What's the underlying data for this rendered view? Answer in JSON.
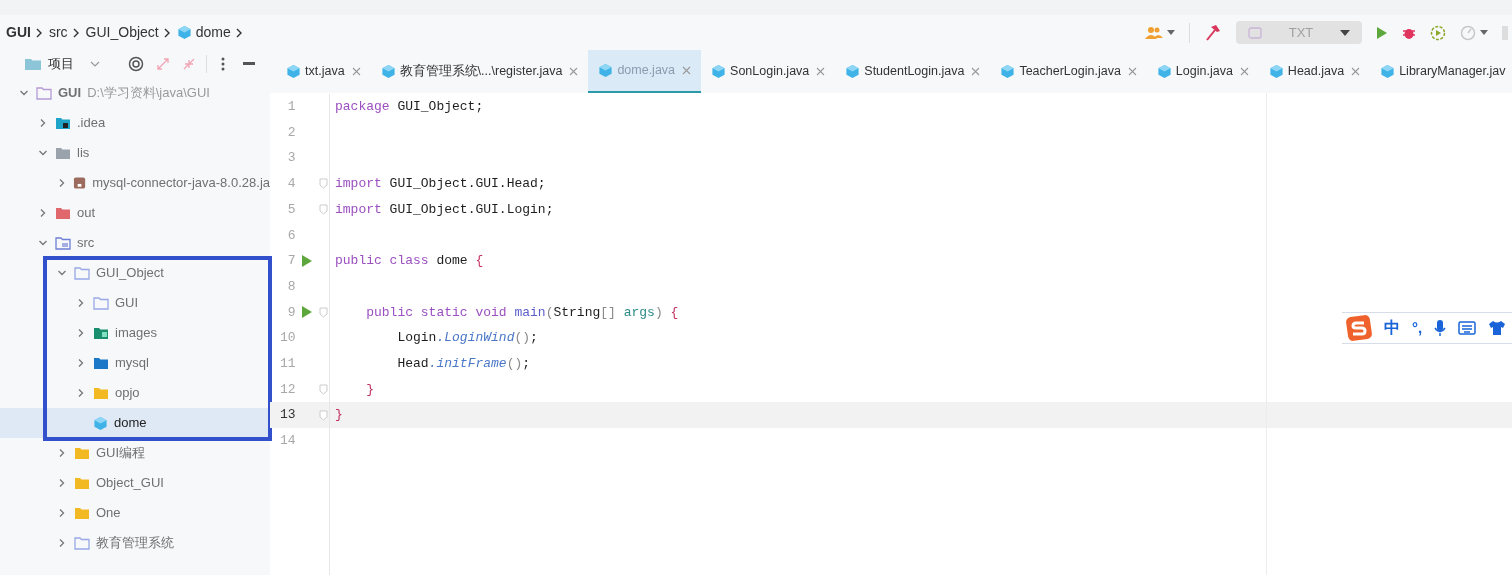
{
  "breadcrumbs": [
    {
      "label": "GUI",
      "bold": true
    },
    {
      "label": "src",
      "bold": false
    },
    {
      "label": "GUI_Object",
      "bold": false
    },
    {
      "label": "dome",
      "bold": false,
      "kind": "class"
    }
  ],
  "toolbar": {
    "run_config": {
      "label": "TXT",
      "disabled": true
    }
  },
  "project_panel": {
    "title": "项目",
    "tree": [
      {
        "label": "GUI",
        "path": "D:\\学习资料\\java\\GUI",
        "kind": "module",
        "expanded": true,
        "selected": false,
        "children": [
          {
            "label": ".idea",
            "kind": "idea",
            "expanded": false,
            "selected": false
          },
          {
            "label": "lis",
            "kind": "plain",
            "expanded": true,
            "selected": false,
            "children": [
              {
                "label": "mysql-connector-java-8.0.28.ja",
                "kind": "jar",
                "expanded": false,
                "selected": false
              }
            ]
          },
          {
            "label": "out",
            "kind": "excluded",
            "expanded": false,
            "selected": false
          },
          {
            "label": "src",
            "kind": "source",
            "expanded": true,
            "selected": false,
            "children": [
              {
                "label": "GUI_Object",
                "kind": "package",
                "expanded": true,
                "selected": false,
                "highlighted": true,
                "children": [
                  {
                    "label": "GUI",
                    "kind": "package",
                    "expanded": false,
                    "selected": false
                  },
                  {
                    "label": "images",
                    "kind": "resources",
                    "expanded": false,
                    "selected": false
                  },
                  {
                    "label": "mysql",
                    "kind": "blue",
                    "expanded": false,
                    "selected": false
                  },
                  {
                    "label": "opjo",
                    "kind": "yellow",
                    "expanded": false,
                    "selected": false
                  },
                  {
                    "label": "dome",
                    "kind": "class",
                    "selected": true
                  }
                ]
              },
              {
                "label": "GUI编程",
                "kind": "yellow",
                "expanded": false,
                "selected": false
              },
              {
                "label": "Object_GUI",
                "kind": "yellow",
                "expanded": false,
                "selected": false
              },
              {
                "label": "One",
                "kind": "yellow",
                "expanded": false,
                "selected": false
              },
              {
                "label": "教育管理系统",
                "kind": "package",
                "expanded": false,
                "selected": false
              }
            ]
          }
        ]
      }
    ]
  },
  "tabs": [
    {
      "label": "txt.java",
      "selected": false,
      "close": true
    },
    {
      "label": "教育管理系统\\...\\register.java",
      "selected": false,
      "close": true
    },
    {
      "label": "dome.java",
      "selected": true,
      "close": true
    },
    {
      "label": "SonLogin.java",
      "selected": false,
      "close": true
    },
    {
      "label": "StudentLogin.java",
      "selected": false,
      "close": true
    },
    {
      "label": "TeacherLogin.java",
      "selected": false,
      "close": true
    },
    {
      "label": "Login.java",
      "selected": false,
      "close": true
    },
    {
      "label": "Head.java",
      "selected": false,
      "close": true
    },
    {
      "label": "LibraryManager.jav",
      "selected": false,
      "close": false
    }
  ],
  "editor": {
    "lines": [
      {
        "number": "1",
        "run": false,
        "fold": false,
        "current": false,
        "tokens": [
          {
            "t": "package",
            "kind": "kw"
          },
          {
            "t": " GUI_Object;",
            "kind": "pl"
          }
        ]
      },
      {
        "number": "2",
        "run": false,
        "fold": false,
        "current": false
      },
      {
        "number": "3",
        "run": false,
        "fold": false,
        "current": false
      },
      {
        "number": "4",
        "run": false,
        "fold": true,
        "current": false,
        "tokens": [
          {
            "t": "import",
            "kind": "kw"
          },
          {
            "t": " GUI_Object.GUI.Head;",
            "kind": "pl"
          }
        ]
      },
      {
        "number": "5",
        "run": false,
        "fold": true,
        "current": false,
        "tokens": [
          {
            "t": "import",
            "kind": "kw"
          },
          {
            "t": " GUI_Object.GUI.Login;",
            "kind": "pl"
          }
        ]
      },
      {
        "number": "6",
        "run": false,
        "fold": false,
        "current": false
      },
      {
        "number": "7",
        "run": true,
        "fold": false,
        "current": false,
        "tokens": [
          {
            "t": "public class",
            "kind": "kw"
          },
          {
            "t": " dome ",
            "kind": "pl"
          },
          {
            "t": "{",
            "kind": "brace"
          }
        ]
      },
      {
        "number": "8",
        "run": false,
        "fold": false,
        "current": false
      },
      {
        "number": "9",
        "run": true,
        "fold": true,
        "current": false,
        "tokens": [
          {
            "t": "    public static void",
            "kind": "kw"
          },
          {
            "t": " main",
            "kind": "decl"
          },
          {
            "t": "(",
            "kind": "paren"
          },
          {
            "t": "String",
            "kind": "pl"
          },
          {
            "t": "[]",
            "kind": "paren"
          },
          {
            "t": " args",
            "kind": "param"
          },
          {
            "t": ")",
            "kind": "paren"
          },
          {
            "t": " {",
            "kind": "brace"
          }
        ]
      },
      {
        "number": "10",
        "run": false,
        "fold": false,
        "current": false,
        "tokens": [
          {
            "t": "        Login",
            "kind": "pl"
          },
          {
            "t": ".LoginWind",
            "kind": "static"
          },
          {
            "t": "()",
            "kind": "paren"
          },
          {
            "t": ";",
            "kind": "pl"
          }
        ]
      },
      {
        "number": "11",
        "run": false,
        "fold": false,
        "current": false,
        "tokens": [
          {
            "t": "        Head",
            "kind": "pl"
          },
          {
            "t": ".initFrame",
            "kind": "static"
          },
          {
            "t": "()",
            "kind": "paren"
          },
          {
            "t": ";",
            "kind": "pl"
          }
        ]
      },
      {
        "number": "12",
        "run": false,
        "fold": true,
        "current": false,
        "tokens": [
          {
            "t": "    }",
            "kind": "brace"
          }
        ]
      },
      {
        "number": "13",
        "run": false,
        "fold": true,
        "current": true,
        "tokens": [
          {
            "t": "}",
            "kind": "brace"
          }
        ]
      },
      {
        "number": "14",
        "run": false,
        "fold": false,
        "current": false
      }
    ]
  },
  "ime": {
    "mode": "中",
    "punct": "°,"
  }
}
